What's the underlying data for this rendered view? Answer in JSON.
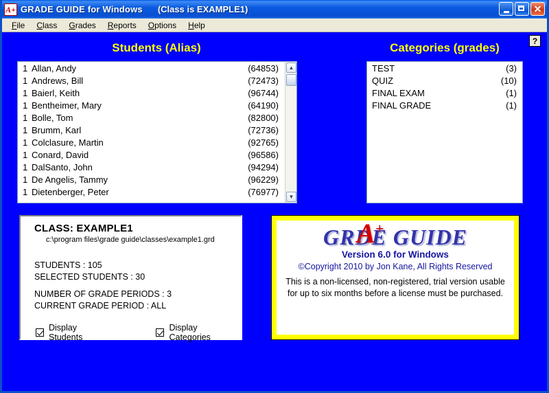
{
  "window": {
    "app_icon_label": "A+",
    "title": "GRADE GUIDE for Windows",
    "class_indicator": "(Class is EXAMPLE1)",
    "minimize_label": "_",
    "maximize_label": "□",
    "close_label": "✕"
  },
  "menubar": {
    "items": [
      {
        "accel": "F",
        "rest": "ile"
      },
      {
        "accel": "C",
        "rest": "lass"
      },
      {
        "accel": "G",
        "rest": "rades"
      },
      {
        "accel": "R",
        "rest": "eports"
      },
      {
        "accel": "O",
        "rest": "ptions"
      },
      {
        "accel": "H",
        "rest": "elp"
      }
    ]
  },
  "help_button": {
    "label": "?"
  },
  "students": {
    "title": "Students (Alias)",
    "scroll_up": "▲",
    "scroll_down": "▼",
    "rows": [
      {
        "sel": "1",
        "name": "Allan, Andy",
        "alias": "(64853)"
      },
      {
        "sel": "1",
        "name": "Andrews, Bill",
        "alias": "(72473)"
      },
      {
        "sel": "1",
        "name": "Baierl, Keith",
        "alias": "(96744)"
      },
      {
        "sel": "1",
        "name": "Bentheimer, Mary",
        "alias": "(64190)"
      },
      {
        "sel": "1",
        "name": "Bolle, Tom",
        "alias": "(82800)"
      },
      {
        "sel": "1",
        "name": "Brumm, Karl",
        "alias": "(72736)"
      },
      {
        "sel": "1",
        "name": "Colclasure, Martin",
        "alias": "(92765)"
      },
      {
        "sel": "1",
        "name": "Conard, David",
        "alias": "(96586)"
      },
      {
        "sel": "1",
        "name": "DalSanto, John",
        "alias": "(94294)"
      },
      {
        "sel": "1",
        "name": "De Angelis, Tammy",
        "alias": "(96229)"
      },
      {
        "sel": "1",
        "name": "Dietenberger, Peter",
        "alias": "(76977)"
      }
    ]
  },
  "categories": {
    "title": "Categories  (grades)",
    "rows": [
      {
        "name": "TEST",
        "count": "(3)"
      },
      {
        "name": "QUIZ",
        "count": "(10)"
      },
      {
        "name": "FINAL EXAM",
        "count": "(1)"
      },
      {
        "name": "FINAL GRADE",
        "count": "(1)"
      }
    ]
  },
  "class_panel": {
    "class_title": "CLASS: EXAMPLE1",
    "path": "c:\\program files\\grade guide\\classes\\example1.grd",
    "students_line": "STUDENTS : 105",
    "selected_line": "SELECTED STUDENTS : 30",
    "periods_line": "NUMBER OF GRADE PERIODS : 3",
    "current_period_line": "CURRENT GRADE PERIOD : ALL",
    "display_students_label": "Display Students",
    "display_categories_label": "Display Categories"
  },
  "logo_panel": {
    "logo_prefix": "GR",
    "logo_big_a": "A",
    "logo_plus": "+",
    "logo_suffix": "DE GUIDE",
    "version": "Version 6.0 for Windows",
    "copyright": "©Copyright 2010 by Jon Kane, All Rights Reserved",
    "trial_line1": "This is a non-licensed, non-registered, trial version usable",
    "trial_line2": "for up to six months before a license must be purchased."
  },
  "colors": {
    "desktop_blue": "#0000FF",
    "heading_yellow": "#FFFF00",
    "logo_blue": "#3333AA",
    "logo_red": "#D40000",
    "titlebar_blue": "#0A5AE0"
  }
}
